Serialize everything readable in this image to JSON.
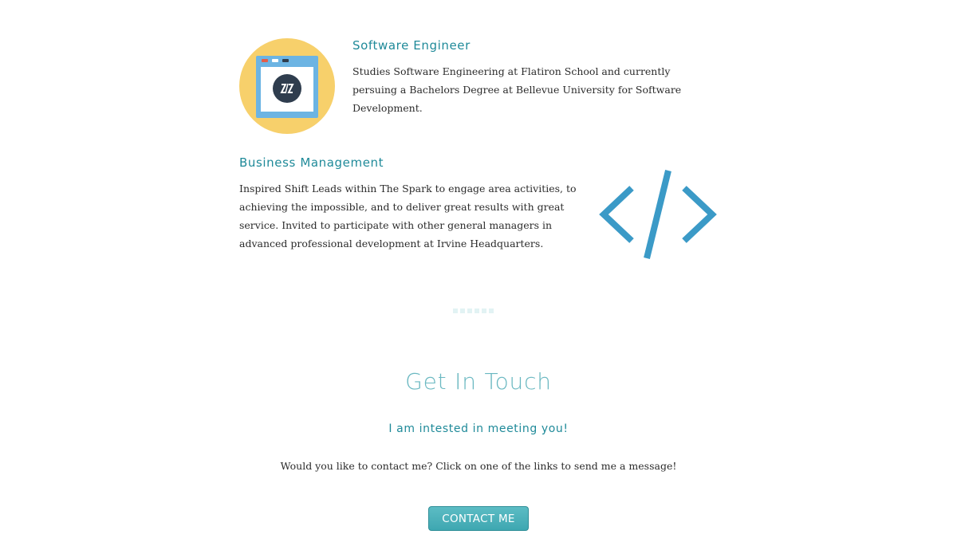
{
  "software": {
    "title": "Software Engineer",
    "text": "Studies Software Engineering at Flatiron School and currently persuing a Bachelors Degree at Bellevue University for Software Development.",
    "icon": "browser-window-icon"
  },
  "business": {
    "title": "Business Management",
    "text": "Inspired Shift Leads within The Spark to engage area activities, to achieving the impossible, and to deliver great results with great service. Invited to participate with other general managers in advanced professional development at Irvine Headquarters.",
    "icon": "code-brackets-icon"
  },
  "contact": {
    "title": "Get In Touch",
    "subtitle": "I am intested in meeting you!",
    "text": "Would you like to contact me? Click on one of the links to send me a message!",
    "button_label": "CONTACT ME"
  },
  "colors": {
    "accent": "#1f8a99",
    "heading_light": "#6ab8c1",
    "icon_yellow": "#f7d06b",
    "icon_blue": "#3b9ac7",
    "button": "#4fb3bc"
  }
}
